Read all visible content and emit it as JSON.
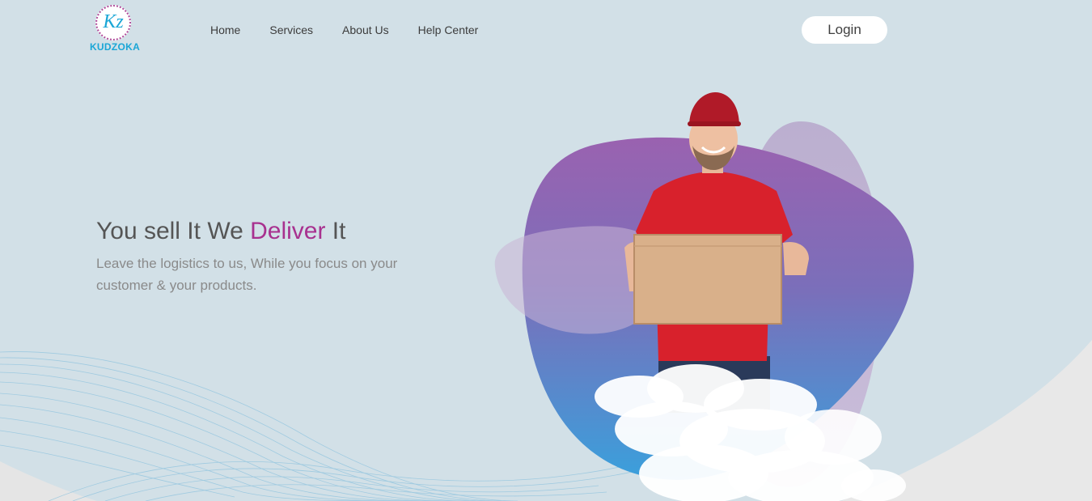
{
  "brand": {
    "logo_mark": "Kz",
    "name": "KUDZOKA"
  },
  "nav": [
    {
      "label": "Home"
    },
    {
      "label": "Services"
    },
    {
      "label": "About Us"
    },
    {
      "label": "Help Center"
    }
  ],
  "header": {
    "login_label": "Login"
  },
  "hero": {
    "title_part1": "You sell It We ",
    "title_accent": "Deliver",
    "title_part2": " It",
    "subtitle": "Leave the logistics to us, While you focus on your customer & your products."
  },
  "colors": {
    "background": "#d2e0e7",
    "accent": "#a8318f",
    "brand": "#1aa6d6",
    "blob_top": "#9a62b0",
    "blob_bottom": "#3aa0dc",
    "shirt": "#d8212c"
  },
  "icons": {
    "hero_image": "delivery-man-with-box"
  }
}
